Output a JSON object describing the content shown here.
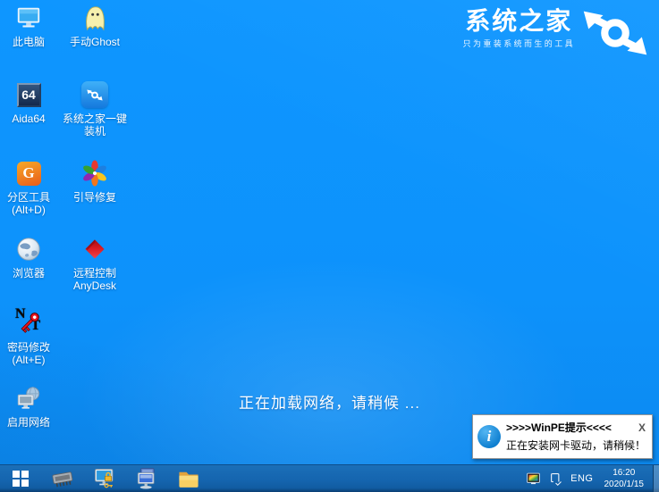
{
  "desktop": {
    "icons": [
      {
        "name": "this-pc",
        "label": "此电脑"
      },
      {
        "name": "manual-ghost",
        "label": "手动Ghost"
      },
      {
        "name": "aida64",
        "label": "Aida64",
        "badge": "64"
      },
      {
        "name": "syshome-onekey-install",
        "label": "系统之家一键\n装机"
      },
      {
        "name": "partition-tool",
        "label": "分区工具\n(Alt+D)",
        "badge": "G"
      },
      {
        "name": "boot-repair",
        "label": "引导修复"
      },
      {
        "name": "browser",
        "label": "浏览器"
      },
      {
        "name": "anydesk-remote",
        "label": "远程控制\nAnyDesk"
      },
      {
        "name": "password-reset",
        "label": "密码修改\n(Alt+E)",
        "badge_n": "N",
        "badge_t": "T"
      },
      {
        "name": "enable-network",
        "label": "启用网络"
      }
    ]
  },
  "brand": {
    "title": "系统之家",
    "subtitle": "只为重装系统而生的工具"
  },
  "status": {
    "loading_message": "正在加载网络，请稍候 ..."
  },
  "notification": {
    "title": ">>>>WinPE提示<<<<",
    "body": "正在安装网卡驱动，请稍候！",
    "close": "X",
    "info": "i"
  },
  "taskbar": {
    "language": "ENG",
    "time": "16:20",
    "date": "2020/1/15"
  },
  "colors": {
    "desktop_blue": "#0d93fc",
    "taskbar_blue": "#1565af",
    "notification_info_blue": "#0f7fd0",
    "brand_text": "#ffffff"
  }
}
